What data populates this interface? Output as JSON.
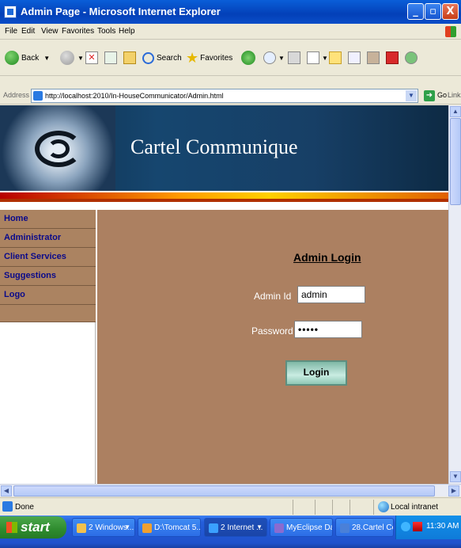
{
  "window": {
    "title": "Admin Page - Microsoft Internet Explorer",
    "controls": {
      "minimize": "_",
      "maximize": "▫",
      "close": "X"
    }
  },
  "menu": [
    "File",
    "Edit",
    "View",
    "Favorites",
    "Tools",
    "Help"
  ],
  "toolbar": {
    "back_label": "Back",
    "search_label": "Search",
    "favorites_label": "Favorites"
  },
  "address": {
    "label": "Address",
    "url": "http://localhost:2010/In-HouseCommunicator/Admin.html",
    "go_label": "Go",
    "links_label": "Links"
  },
  "page": {
    "brand": "Cartel Communique",
    "nav": [
      "Home",
      "Administrator",
      "Client Services",
      "Suggestions",
      "Logo"
    ],
    "login_title": "Admin Login",
    "admin_id_label": "Admin Id",
    "admin_id_value": "admin",
    "password_label": "Password",
    "password_value": "•••••",
    "login_button": "Login"
  },
  "status": {
    "text": "Done",
    "zone": "Local intranet"
  },
  "taskbar": {
    "start": "start",
    "tasks": [
      {
        "label": "2 Windows...",
        "color": "#f2c14e"
      },
      {
        "label": "D:\\Tomcat 5...",
        "color": "#f0a030"
      },
      {
        "label": "2 Internet ...",
        "color": "#3aa0ff"
      },
      {
        "label": "MyEclipse Da...",
        "color": "#8a6bd0"
      },
      {
        "label": "28.Cartel Co...",
        "color": "#4a80d8"
      }
    ],
    "clock": "11:30 AM"
  },
  "colors": {
    "nav_bg": "#ab8361",
    "main_bg": "#ac8061",
    "nav_text": "#0a0a8a"
  }
}
